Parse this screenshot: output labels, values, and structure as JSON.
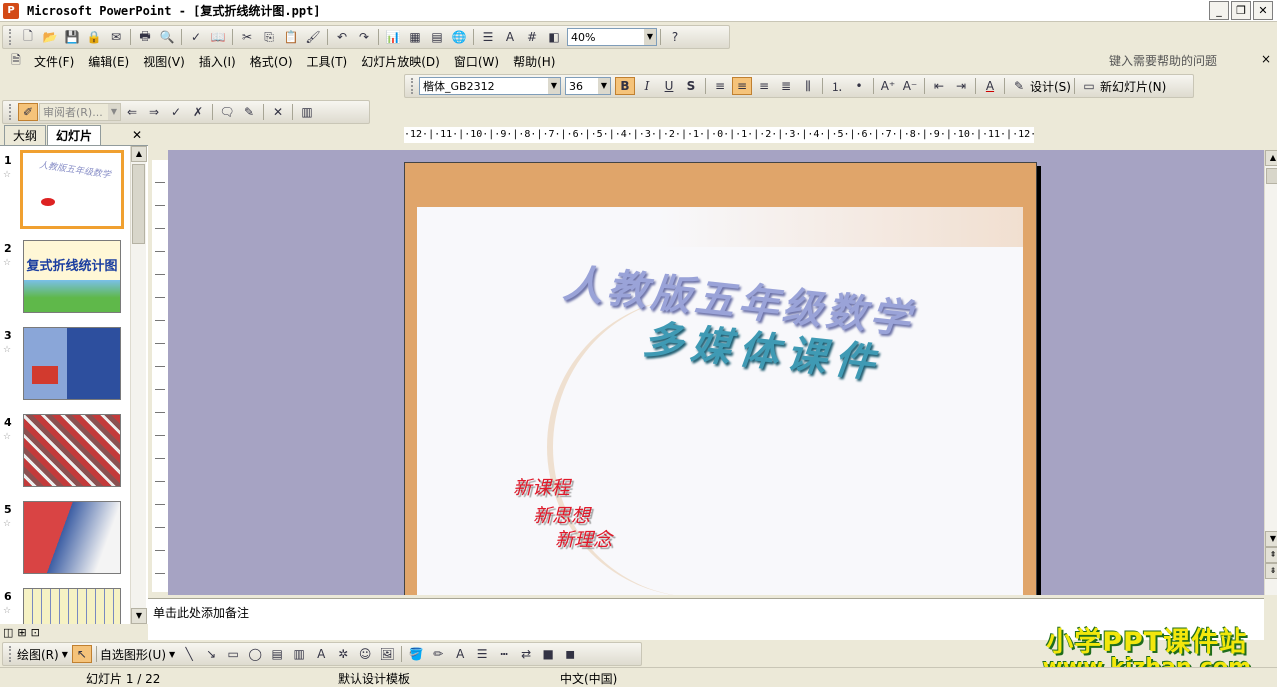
{
  "window": {
    "title": "Microsoft PowerPoint - [复式折线统计图.ppt]"
  },
  "toolbar_standard": {
    "zoom": "40%"
  },
  "menu": {
    "items": [
      "文件(F)",
      "编辑(E)",
      "视图(V)",
      "插入(I)",
      "格式(O)",
      "工具(T)",
      "幻灯片放映(D)",
      "窗口(W)",
      "帮助(H)"
    ]
  },
  "help": {
    "placeholder": "键入需要帮助的问题"
  },
  "format_toolbar": {
    "font": "楷体_GB2312",
    "size": "36",
    "bold": "B",
    "italic": "I",
    "underline": "U",
    "shadow": "S",
    "design_label": "设计(S)",
    "new_slide_label": "新幻灯片(N)"
  },
  "review_toolbar": {
    "reviewer": "审阅者(R)..."
  },
  "pane": {
    "tab_outline": "大纲",
    "tab_slides": "幻灯片"
  },
  "thumbnails": [
    {
      "num": "1",
      "colors": [
        "#f4ede0",
        "#c4cbe8"
      ],
      "text": "人教版五年级数学"
    },
    {
      "num": "2",
      "colors": [
        "#fff7d6",
        "#5fb84a"
      ],
      "text": "复式折线统计图"
    },
    {
      "num": "3",
      "colors": [
        "#8aa6d8",
        "#d23a2e"
      ],
      "text": ""
    },
    {
      "num": "4",
      "colors": [
        "#c33a3a",
        "#8a5050"
      ],
      "text": ""
    },
    {
      "num": "5",
      "colors": [
        "#d94444",
        "#3c5ea4"
      ],
      "text": ""
    },
    {
      "num": "6",
      "colors": [
        "#f6f2c4",
        "#7a8ac0"
      ],
      "text": ""
    }
  ],
  "ruler": {
    "horizontal": "·12·|·11·|·10·|·9·|·8·|·7·|·6·|·5·|·4·|·3·|·2·|·1·|·0·|·1·|·2·|·3·|·4·|·5·|·6·|·7·|·8·|·9·|·10·|·11·|·12·"
  },
  "slide": {
    "title_line1": "人教版五年级数学",
    "title_line2": "多媒体课件",
    "slogans": [
      "新课程",
      "新思想",
      "新理念"
    ]
  },
  "notes": {
    "placeholder": "单击此处添加备注"
  },
  "drawing_toolbar": {
    "draw": "绘图(R)",
    "autoshapes": "自选图形(U)"
  },
  "status": {
    "slide": "幻灯片 1 / 22",
    "design": "默认设计模板",
    "language": "中文(中国)"
  },
  "watermark": {
    "line1": "小学PPT课件站",
    "line2": "www.kjzhan.com"
  }
}
